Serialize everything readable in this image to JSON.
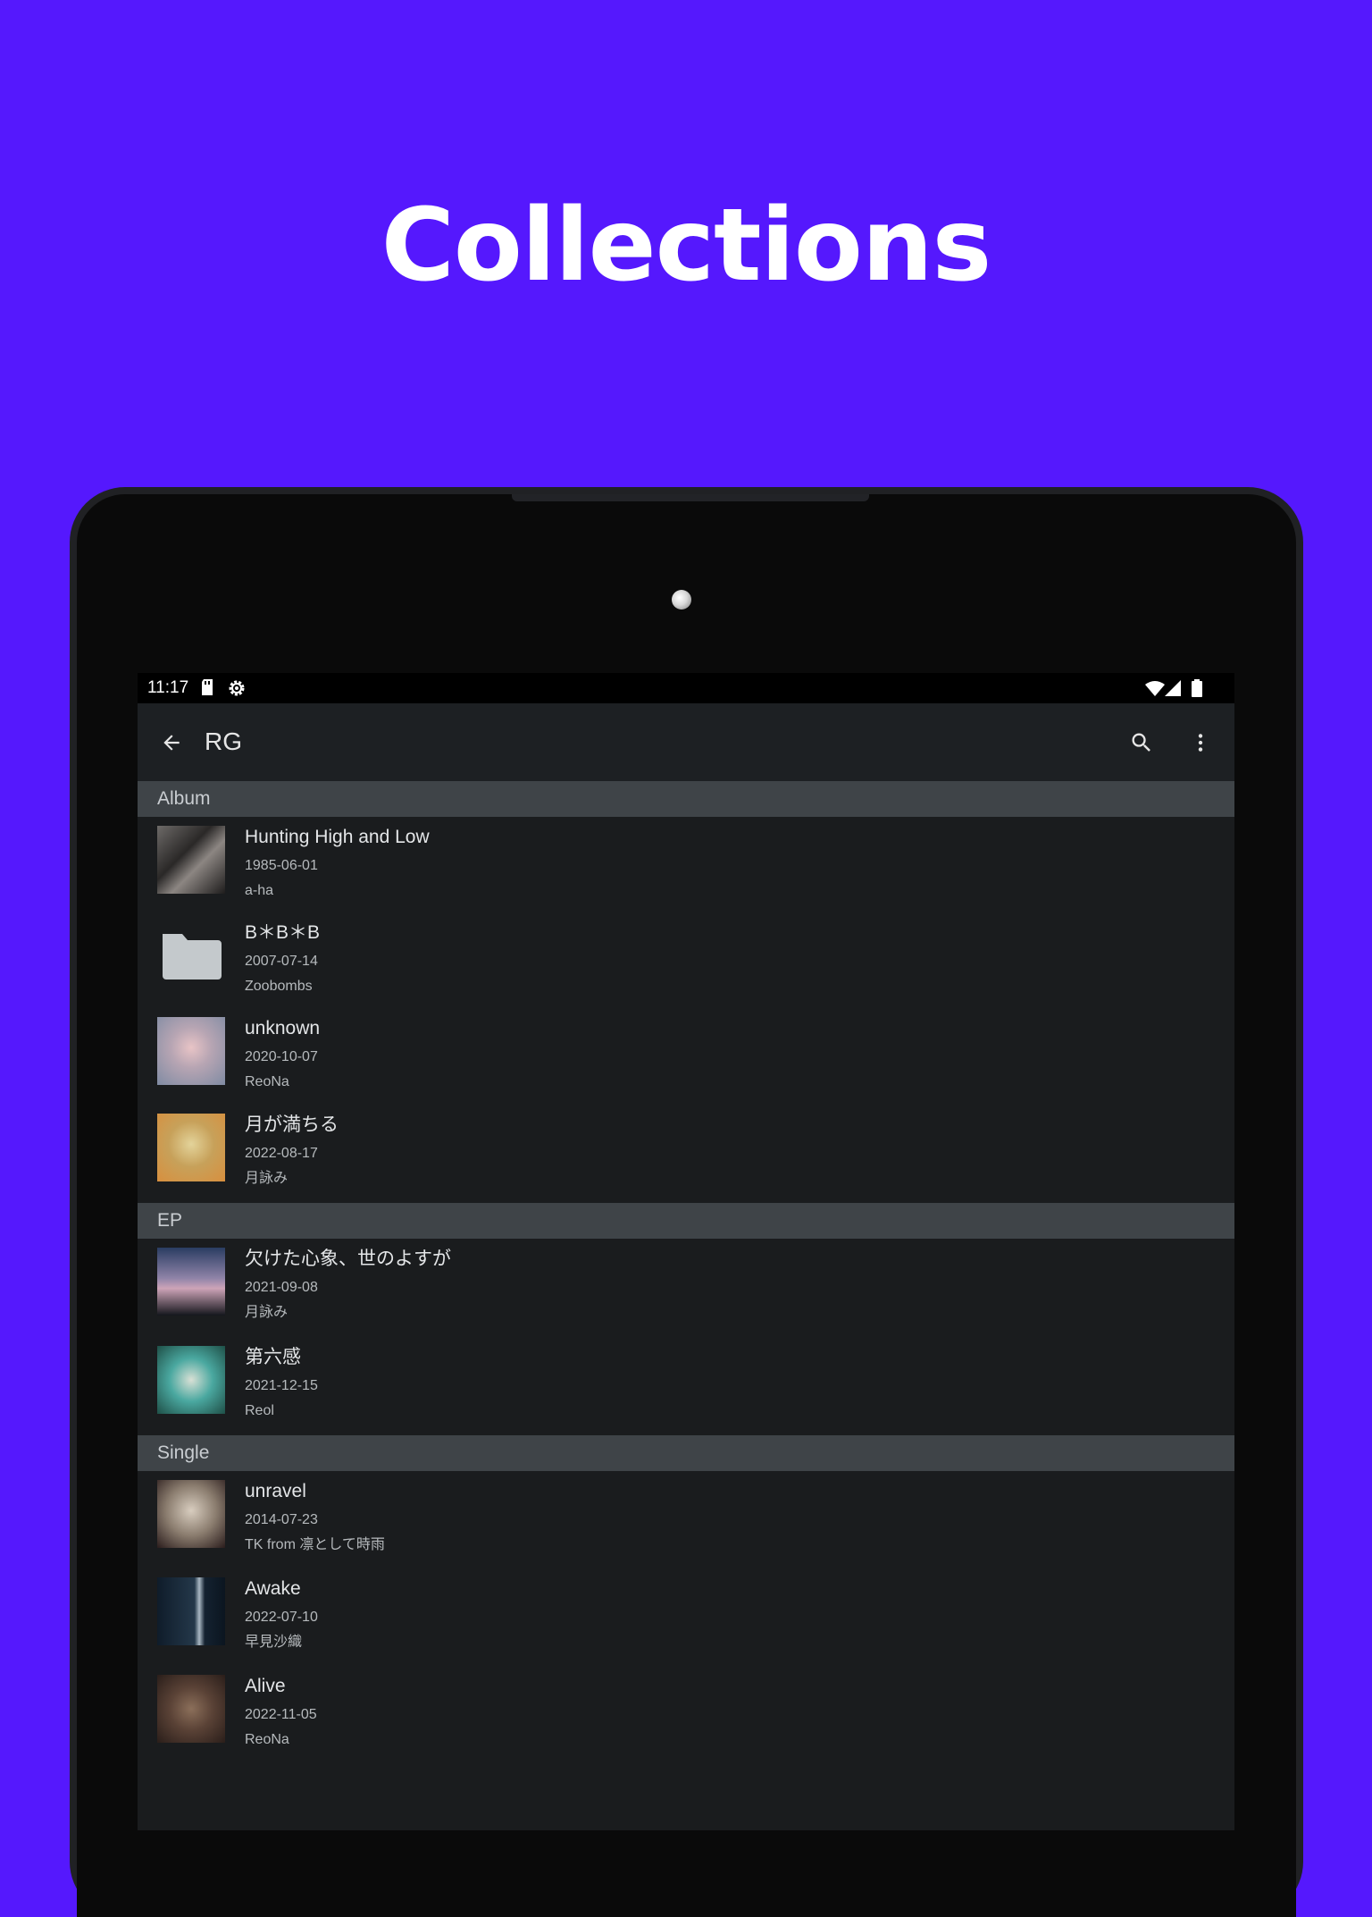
{
  "headline": "Collections",
  "status": {
    "time": "11:17"
  },
  "appbar": {
    "title": "RG",
    "back_icon": "arrow-back-icon",
    "search_icon": "search-icon",
    "menu_icon": "more-vert-icon"
  },
  "sections": [
    {
      "label": "Album",
      "items": [
        {
          "title": "Hunting High and Low",
          "date": "1985-06-01",
          "artist": "a-ha"
        },
        {
          "title": "B＊B＊B",
          "date": "2007-07-14",
          "artist": "Zoobombs"
        },
        {
          "title": "unknown",
          "date": "2020-10-07",
          "artist": "ReoNa"
        },
        {
          "title": "月が満ちる",
          "date": "2022-08-17",
          "artist": "月詠み"
        }
      ]
    },
    {
      "label": "EP",
      "items": [
        {
          "title": "欠けた心象、世のよすが",
          "date": "2021-09-08",
          "artist": "月詠み"
        },
        {
          "title": "第六感",
          "date": "2021-12-15",
          "artist": "Reol"
        }
      ]
    },
    {
      "label": "Single",
      "items": [
        {
          "title": "unravel",
          "date": "2014-07-23",
          "artist": "TK from 凛として時雨"
        },
        {
          "title": "Awake",
          "date": "2022-07-10",
          "artist": "早見沙織"
        },
        {
          "title": "Alive",
          "date": "2022-11-05",
          "artist": "ReoNa"
        }
      ]
    }
  ],
  "colors": {
    "background": "#5518fd",
    "screen": "#1a1c1e",
    "section_header": "#3f4448"
  }
}
